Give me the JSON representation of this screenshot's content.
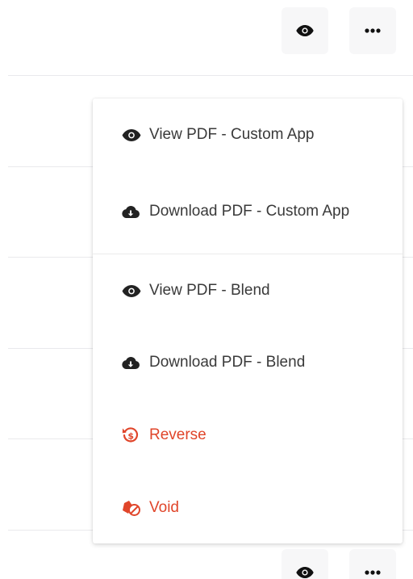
{
  "colors": {
    "danger": "#e0452a",
    "text": "#3a3a3a",
    "icon": "#222222",
    "divider": "#e9e9ec"
  },
  "toolbar_top": {
    "view_icon": "eye-icon",
    "more_icon": "ellipsis-icon"
  },
  "toolbar_bottom": {
    "view_icon": "eye-icon",
    "more_icon": "ellipsis-icon"
  },
  "menu": {
    "items": [
      {
        "label": "View PDF - Custom App",
        "icon": "eye-icon"
      },
      {
        "label": "Download PDF - Custom App",
        "icon": "cloud-download-icon"
      },
      {
        "label": "View PDF - Blend",
        "icon": "eye-icon"
      },
      {
        "label": "Download PDF - Blend",
        "icon": "cloud-download-icon"
      },
      {
        "label": "Reverse",
        "icon": "reverse-payment-icon"
      },
      {
        "label": "Void",
        "icon": "void-icon"
      }
    ]
  }
}
